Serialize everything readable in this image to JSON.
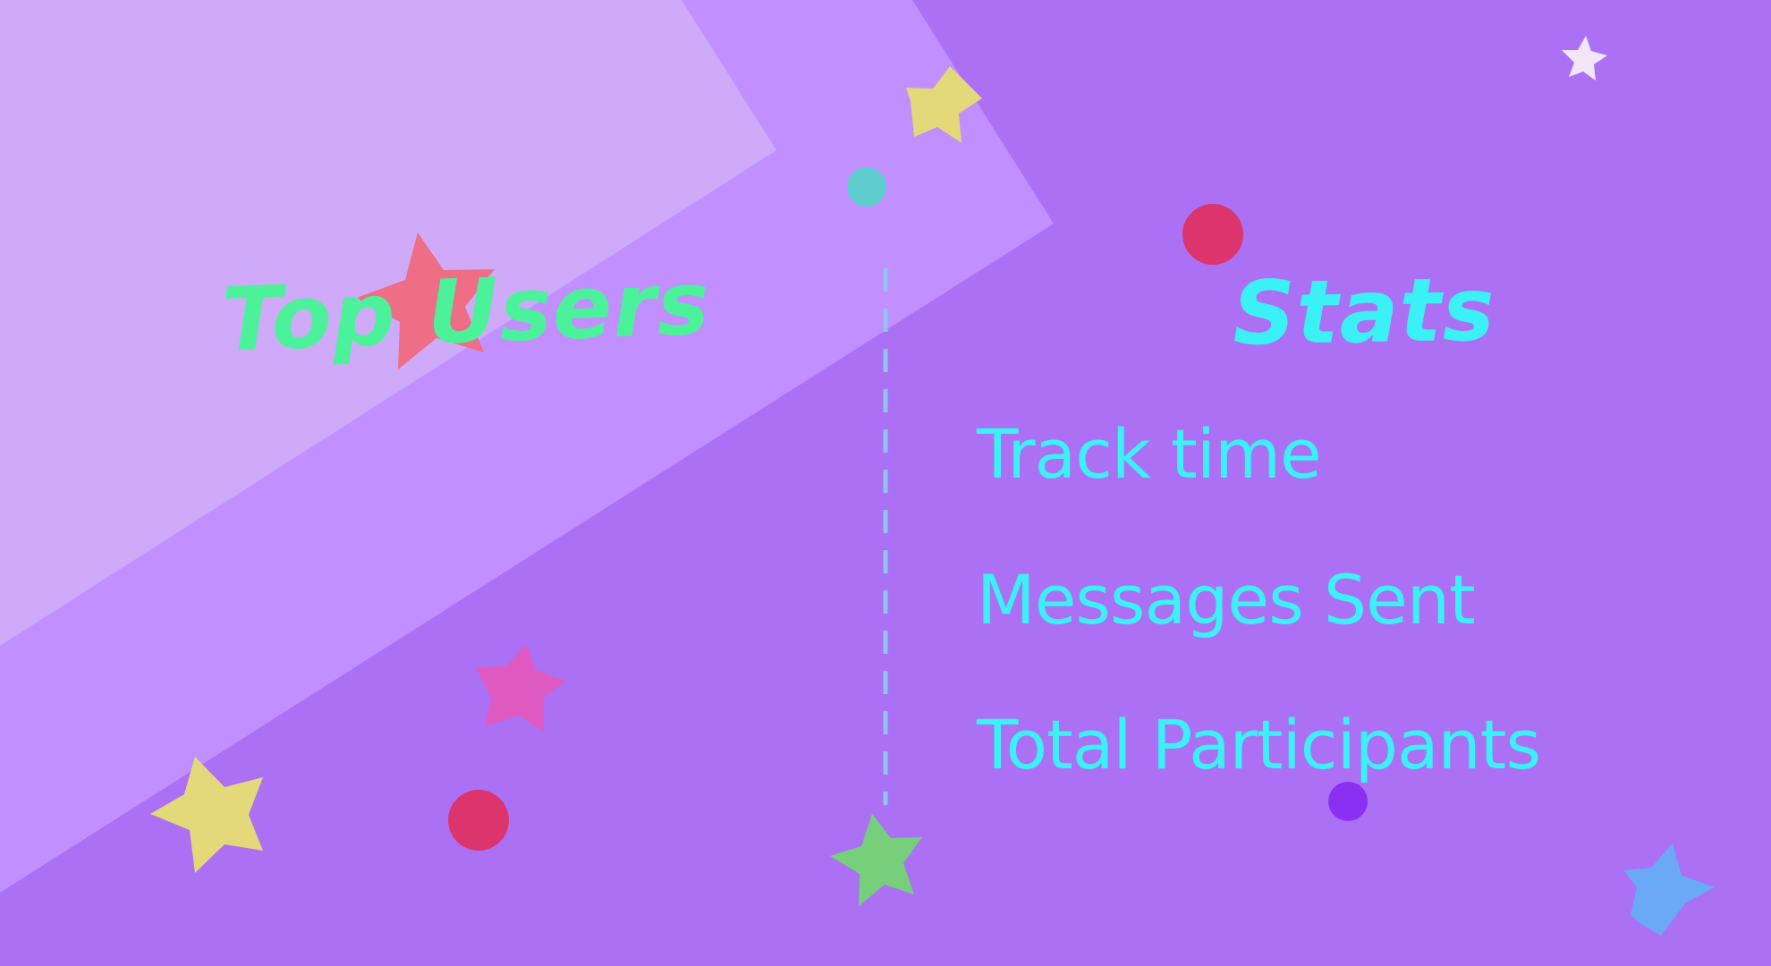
{
  "left_panel": {
    "title": "Top Users"
  },
  "right_panel": {
    "title": "Stats",
    "items": [
      {
        "label": "Track time"
      },
      {
        "label": "Messages Sent"
      },
      {
        "label": "Total Participants"
      }
    ]
  },
  "colors": {
    "background": "#ab70f4",
    "panel_light": "#cfaaf9",
    "panel_mid": "#c18fff",
    "top_users_title": "#4cf29a",
    "stats_text": "#3cf1f6",
    "divider": "#8fc4f0",
    "star_yellow": "#e3d87a",
    "star_red": "#ee6e86",
    "star_pink": "#e05ac4",
    "star_green": "#77cf7c",
    "star_blue": "#6aa9f6",
    "star_white": "#f1e6fb",
    "dot_crimson": "#dc346c",
    "dot_teal": "#5ccccc",
    "dot_violet": "#8b30f2"
  },
  "decorations": {
    "shapes": [
      "star-icon",
      "dot-icon",
      "dashed-divider"
    ]
  }
}
